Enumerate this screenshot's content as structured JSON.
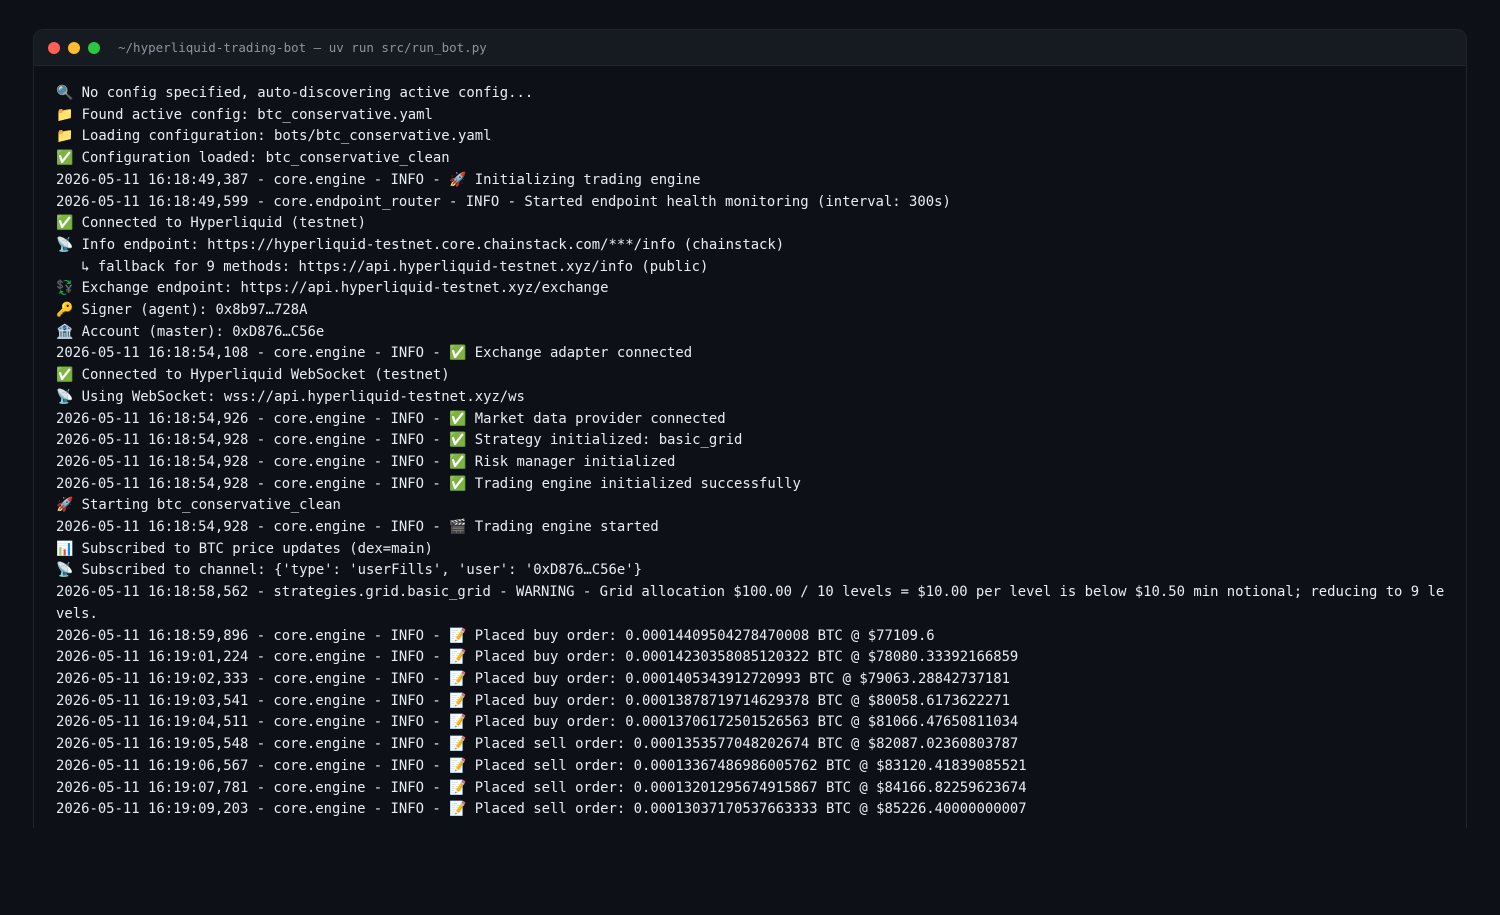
{
  "window": {
    "title": "~/hyperliquid-trading-bot — uv run src/run_bot.py"
  },
  "colors": {
    "background": "#0d1117",
    "titlebar": "#161b22",
    "text": "#e6edf3",
    "close": "#ff5f57",
    "minimize": "#febc2e",
    "maximize": "#28c840"
  },
  "terminal": {
    "lines": [
      "🔍 No config specified, auto-discovering active config...",
      "📁 Found active config: btc_conservative.yaml",
      "📁 Loading configuration: bots/btc_conservative.yaml",
      "✅ Configuration loaded: btc_conservative_clean",
      "2026-05-11 16:18:49,387 - core.engine - INFO - 🚀 Initializing trading engine",
      "2026-05-11 16:18:49,599 - core.endpoint_router - INFO - Started endpoint health monitoring (interval: 300s)",
      "✅ Connected to Hyperliquid (testnet)",
      "📡 Info endpoint: https://hyperliquid-testnet.core.chainstack.com/***/info (chainstack)",
      "   ↳ fallback for 9 methods: https://api.hyperliquid-testnet.xyz/info (public)",
      "💱 Exchange endpoint: https://api.hyperliquid-testnet.xyz/exchange",
      "🔑 Signer (agent): 0x8b97…728A",
      "🏦 Account (master): 0xD876…C56e",
      "2026-05-11 16:18:54,108 - core.engine - INFO - ✅ Exchange adapter connected",
      "✅ Connected to Hyperliquid WebSocket (testnet)",
      "📡 Using WebSocket: wss://api.hyperliquid-testnet.xyz/ws",
      "2026-05-11 16:18:54,926 - core.engine - INFO - ✅ Market data provider connected",
      "2026-05-11 16:18:54,928 - core.engine - INFO - ✅ Strategy initialized: basic_grid",
      "2026-05-11 16:18:54,928 - core.engine - INFO - ✅ Risk manager initialized",
      "2026-05-11 16:18:54,928 - core.engine - INFO - ✅ Trading engine initialized successfully",
      "🚀 Starting btc_conservative_clean",
      "2026-05-11 16:18:54,928 - core.engine - INFO - 🎬 Trading engine started",
      "📊 Subscribed to BTC price updates (dex=main)",
      "📡 Subscribed to channel: {'type': 'userFills', 'user': '0xD876…C56e'}",
      "2026-05-11 16:18:58,562 - strategies.grid.basic_grid - WARNING - Grid allocation $100.00 / 10 levels = $10.00 per level is below $10.50 min notional; reducing to 9 levels.",
      "2026-05-11 16:18:59,896 - core.engine - INFO - 📝 Placed buy order: 0.00014409504278470008 BTC @ $77109.6",
      "2026-05-11 16:19:01,224 - core.engine - INFO - 📝 Placed buy order: 0.00014230358085120322 BTC @ $78080.33392166859",
      "2026-05-11 16:19:02,333 - core.engine - INFO - 📝 Placed buy order: 0.0001405343912720993 BTC @ $79063.28842737181",
      "2026-05-11 16:19:03,541 - core.engine - INFO - 📝 Placed buy order: 0.00013878719714629378 BTC @ $80058.6173622271",
      "2026-05-11 16:19:04,511 - core.engine - INFO - 📝 Placed buy order: 0.00013706172501526563 BTC @ $81066.47650811034",
      "2026-05-11 16:19:05,548 - core.engine - INFO - 📝 Placed sell order: 0.0001353577048202674 BTC @ $82087.02360803787",
      "2026-05-11 16:19:06,567 - core.engine - INFO - 📝 Placed sell order: 0.00013367486986005762 BTC @ $83120.41839085521",
      "2026-05-11 16:19:07,781 - core.engine - INFO - 📝 Placed sell order: 0.00013201295674915867 BTC @ $84166.82259623674",
      "2026-05-11 16:19:09,203 - core.engine - INFO - 📝 Placed sell order: 0.00013037170537663333 BTC @ $85226.40000000007"
    ]
  }
}
